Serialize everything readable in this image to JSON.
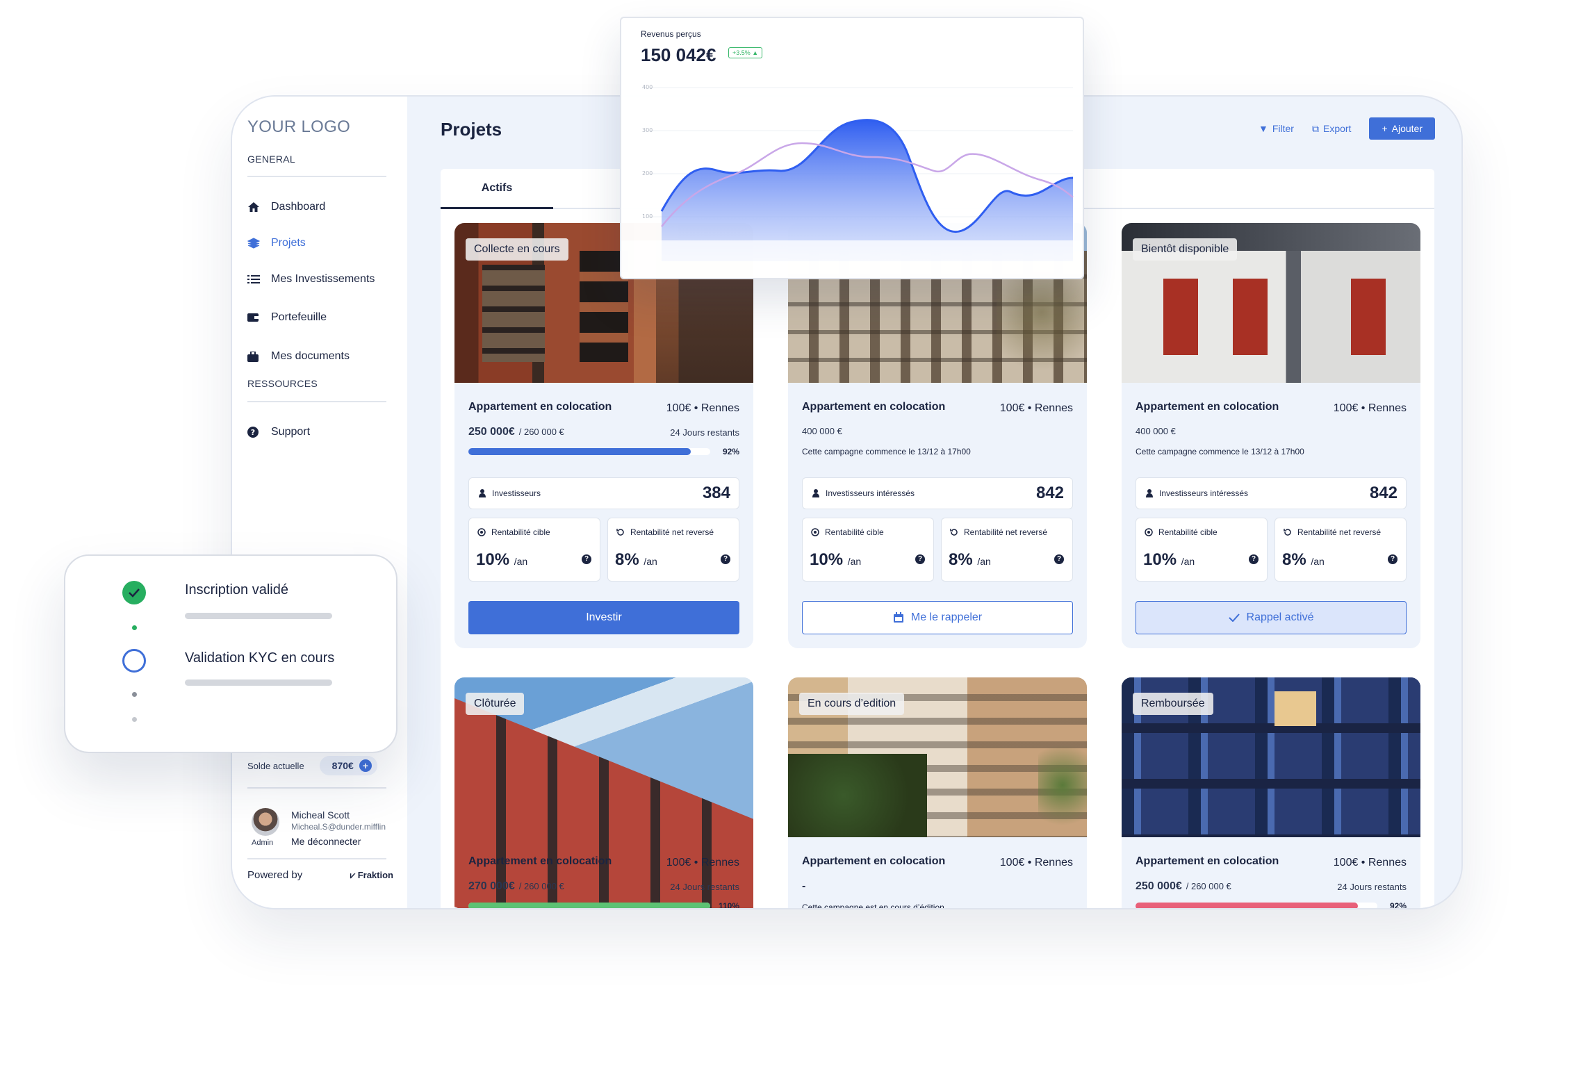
{
  "sidebar": {
    "logo": "YOUR LOGO",
    "section_general": "GENERAL",
    "section_resources": "RESSOURCES",
    "items": [
      {
        "label": "Dashboard",
        "icon": "home-icon"
      },
      {
        "label": "Projets",
        "icon": "layers-icon",
        "active": true
      },
      {
        "label": "Mes Investissements",
        "icon": "list-icon"
      },
      {
        "label": "Portefeuille",
        "icon": "wallet-icon"
      },
      {
        "label": "Mes documents",
        "icon": "briefcase-icon"
      }
    ],
    "support": "Support",
    "balance_label": "Solde actuelle",
    "balance_value": "870€",
    "user": {
      "name": "Micheal Scott",
      "email": "Micheal.S@dunder.mifflin",
      "role": "Admin",
      "logout": "Me déconnecter"
    },
    "powered_by": "Powered by",
    "brand": "Fraktion"
  },
  "header": {
    "title": "Projets",
    "filter": "Filter",
    "export": "Export",
    "add": "Ajouter"
  },
  "tabs": {
    "active": "Actifs"
  },
  "revenue": {
    "label": "Revenus perçus",
    "value": "150 042€",
    "delta": "+3.5% ▲",
    "y_ticks": [
      "400",
      "300",
      "200",
      "100"
    ]
  },
  "kyc": {
    "step1": "Inscription validé",
    "step2": "Validation KYC en cours"
  },
  "projects": [
    {
      "status": "Collecte en cours",
      "title": "Appartement en colocation",
      "price": "100€ • Rennes",
      "amount": "250 000€",
      "target": "/ 260 000 €",
      "days": "24 Jours restants",
      "progress": 0.92,
      "progress_label": "92%",
      "progress_color": "#3f6fd8",
      "stat_label": "Investisseurs",
      "stat_value": "384",
      "rent_label": "Rentabilité cible",
      "rent_value": "10%",
      "net_label": "Rentabilité net reversé",
      "net_value": "8%",
      "unit": "/an",
      "action": "Investir",
      "action_style": "solid"
    },
    {
      "status": "",
      "title": "Appartement en colocation",
      "price": "100€ • Rennes",
      "amount_plain": "400 000 €",
      "campaign": "Cette campagne commence  le 13/12 à 17h00",
      "stat_label": "Investisseurs intéressés",
      "stat_value": "842",
      "rent_label": "Rentabilité cible",
      "rent_value": "10%",
      "net_label": "Rentabilité net reversé",
      "net_value": "8%",
      "unit": "/an",
      "action": "Me le rappeler",
      "action_style": "outline"
    },
    {
      "status": "Bientôt disponible",
      "title": "Appartement en colocation",
      "price": "100€ • Rennes",
      "amount_plain": "400 000 €",
      "campaign": "Cette campagne commence  le 13/12 à 17h00",
      "stat_label": "Investisseurs intéressés",
      "stat_value": "842",
      "rent_label": "Rentabilité cible",
      "rent_value": "10%",
      "net_label": "Rentabilité net reversé",
      "net_value": "8%",
      "unit": "/an",
      "action": "Rappel activé",
      "action_style": "soft"
    },
    {
      "status": "Clôturée",
      "title": "Appartement en colocation",
      "price": "100€ • Rennes",
      "amount": "270 000€",
      "target": "/ 260 000 €",
      "days": "24 Jours restants",
      "progress": 1.0,
      "progress_label": "110%",
      "progress_color": "#5cc274"
    },
    {
      "status": "En cours d’edition",
      "title": "Appartement en colocation",
      "price": "100€ • Rennes",
      "dash": "-",
      "campaign": "Cette campagne est en cours d’édition"
    },
    {
      "status": "Remboursée",
      "title": "Appartement en colocation",
      "price": "100€ • Rennes",
      "amount": "250 000€",
      "target": "/ 260 000 €",
      "days": "24 Jours restants",
      "progress": 0.92,
      "progress_label": "92%",
      "progress_color": "#e8607a"
    }
  ]
}
